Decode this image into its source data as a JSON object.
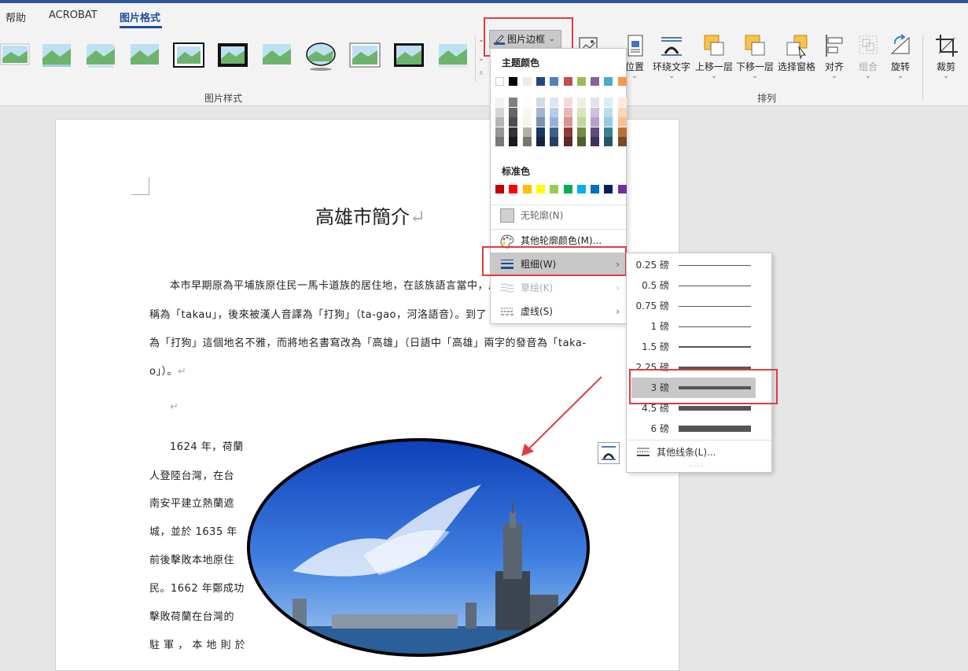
{
  "tabs": {
    "help": "帮助",
    "acrobat": "ACROBAT",
    "picture_format": "图片格式"
  },
  "ribbon": {
    "picture_styles_group": "图片样式",
    "arrange_group": "排列",
    "border_button": "图片边框",
    "arrange_buttons": {
      "position": "位置",
      "wrap_text": "环绕文字",
      "bring_forward": "上移一层",
      "send_backward": "下移一层",
      "selection_pane": "选择窗格",
      "align": "对齐",
      "group": "组合",
      "rotate": "旋转",
      "crop": "裁剪"
    }
  },
  "border_menu": {
    "theme_colors_label": "主题颜色",
    "standard_colors_label": "标准色",
    "no_outline": "无轮廓(N)",
    "more_colors": "其他轮廓颜色(M)...",
    "weight": "粗细(W)",
    "sketched": "草绘(K)",
    "dashes": "虚线(S)",
    "theme_colors": [
      "#ffffff",
      "#000000",
      "#e7e6e6",
      "#44546a",
      "#4472c4",
      "#ed7d31",
      "#a5a5a5",
      "#ffc000",
      "#5b9bd5",
      "#70ad47"
    ],
    "theme_row_colors": [
      "#ffffff",
      "#000000",
      "#eeece1",
      "#1f497d",
      "#4f81bd",
      "#c0504d",
      "#9bbb59",
      "#8064a2",
      "#4bacc6",
      "#f79646"
    ],
    "standard_colors": [
      "#c00000",
      "#ff0000",
      "#ffc000",
      "#ffff00",
      "#92d050",
      "#00b050",
      "#00b0f0",
      "#0070c0",
      "#002060",
      "#7030a0"
    ]
  },
  "weight_menu": {
    "items": [
      {
        "label": "0.25 磅",
        "weight": 0.25
      },
      {
        "label": "0.5 磅",
        "weight": 0.5
      },
      {
        "label": "0.75 磅",
        "weight": 0.75
      },
      {
        "label": "1 磅",
        "weight": 1
      },
      {
        "label": "1.5 磅",
        "weight": 1.5
      },
      {
        "label": "2.25 磅",
        "weight": 2.25
      },
      {
        "label": "3 磅",
        "weight": 3
      },
      {
        "label": "4.5 磅",
        "weight": 4.5
      },
      {
        "label": "6 磅",
        "weight": 6
      }
    ],
    "selected": "3 磅",
    "more_lines": "其他线条(L)..."
  },
  "document": {
    "title": "高雄市簡介",
    "para1_line1": "本市早期原為平埔族原住民一馬卡道族的居住地，在該族語言當中，用",
    "para1_line2": "稱為「takau」，後來被漢人音譯為「打狗」（ta-gao，河洛語音）。到了",
    "para1_line3": "為「打狗」這個地名不雅，而將地名書寫改為「高雄」（日語中「高雄」兩字的發音為「taka-",
    "para1_line4": "o」）。",
    "para2_lines": [
      "1624 年，荷蘭",
      "人登陸台灣，在台",
      "南安平建立熱蘭遮",
      "城，並於 1635 年",
      "前後擊敗本地原住",
      "民。1662 年鄭成功",
      "擊敗荷蘭在台灣的",
      "駐 軍 ， 本 地 則 於"
    ]
  }
}
